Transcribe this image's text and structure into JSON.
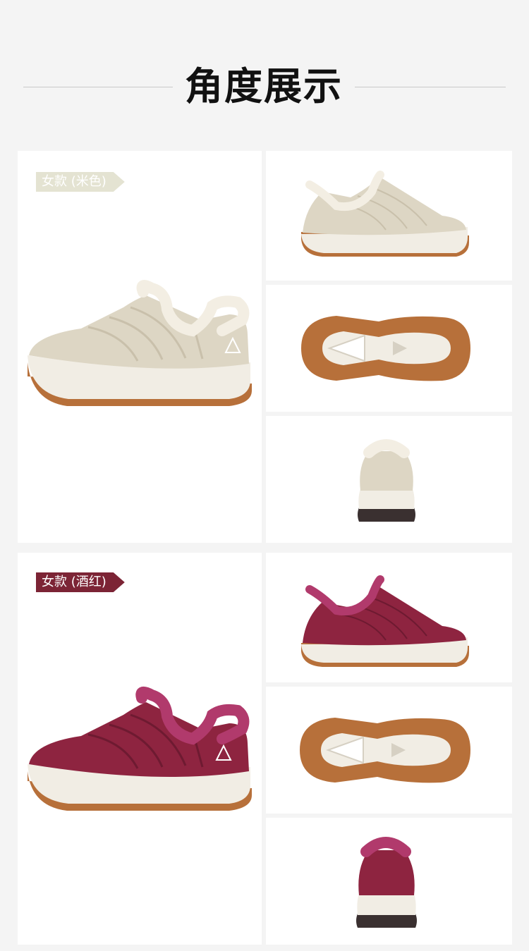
{
  "header": {
    "title": "角度展示"
  },
  "sections": {
    "beige": {
      "tag": "女款 (米色)",
      "colors": {
        "upper": "#ddd6c4",
        "upper_shade": "#c9c0ab",
        "fur": "#f3eee3",
        "sole": "#f1ede4",
        "outsole": "#b7703a",
        "tag_bg": "#e4e3d2"
      }
    },
    "wine": {
      "tag": "女款 (酒红)",
      "colors": {
        "upper": "#8e2440",
        "upper_shade": "#6e1a31",
        "fur": "#b13a6c",
        "sole": "#f1ede4",
        "outsole": "#b7703a",
        "tag_bg": "#7c2435"
      }
    }
  },
  "icons": [
    "shoe-side-view",
    "shoe-sole-view",
    "shoe-back-view"
  ]
}
